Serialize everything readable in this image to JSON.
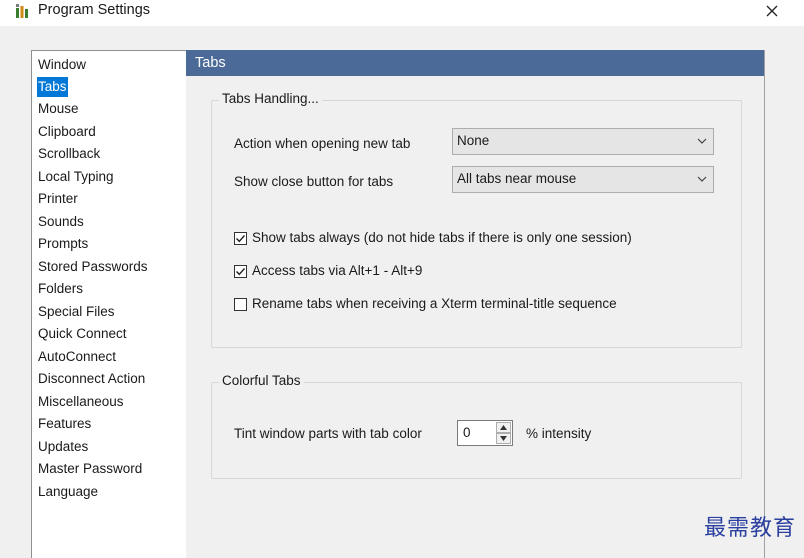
{
  "window": {
    "title": "Program Settings",
    "close_label": "✕"
  },
  "nav": {
    "selected": "Tabs",
    "items": [
      "Window",
      "Tabs",
      "Mouse",
      "Clipboard",
      "Scrollback",
      "Local Typing",
      "Printer",
      "Sounds",
      "Prompts",
      "Stored Passwords",
      "Folders",
      "Special Files",
      "Quick Connect",
      "AutoConnect",
      "Disconnect Action",
      "Miscellaneous",
      "Features",
      "Updates",
      "Master Password",
      "Language"
    ]
  },
  "pane": {
    "header": "Tabs",
    "tabs_handling": {
      "title": "Tabs Handling...",
      "new_tab_label": "Action when opening new tab",
      "new_tab_value": "None",
      "close_button_label": "Show close button for tabs",
      "close_button_value": "All tabs near mouse",
      "options": [
        {
          "label": "Show tabs always (do not hide tabs if there is only one session)",
          "checked": true
        },
        {
          "label": "Access tabs via Alt+1 - Alt+9",
          "checked": true
        },
        {
          "label": "Rename tabs when receiving a Xterm terminal-title sequence",
          "checked": false
        }
      ]
    },
    "colorful_tabs": {
      "title": "Colorful Tabs",
      "tint_label": "Tint window parts with tab color",
      "tint_value": "0",
      "intensity_label": "% intensity"
    }
  },
  "watermark": "最需教育",
  "colors": {
    "header_bg": "#4b6a98",
    "selection": "#0078d7",
    "watermark": "#2a3f9e"
  }
}
